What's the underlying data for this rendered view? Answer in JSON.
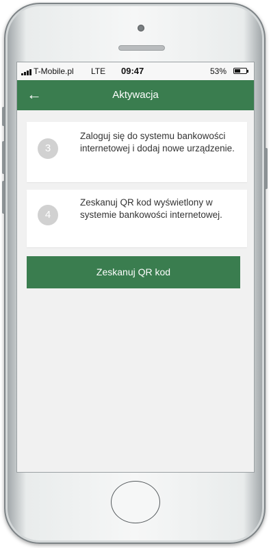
{
  "status_bar": {
    "carrier": "T-Mobile.pl",
    "network": "LTE",
    "time": "09:47",
    "battery_percent": "53%",
    "battery_level": 0.53
  },
  "app_bar": {
    "back_icon": "arrow-left-icon",
    "title": "Aktywacja"
  },
  "steps": [
    {
      "number": "3",
      "text": "Zaloguj się do systemu bankowości internetowej i dodaj nowe urządzenie."
    },
    {
      "number": "4",
      "text": "Zeskanuj QR kod wyświetlony w systemie bankowości internetowej."
    }
  ],
  "scan_button": {
    "label": "Zeskanuj QR kod"
  },
  "colors": {
    "brand_green": "#3a7d4f",
    "step_circle": "#d1d1d1",
    "background": "#f1f1f1"
  }
}
